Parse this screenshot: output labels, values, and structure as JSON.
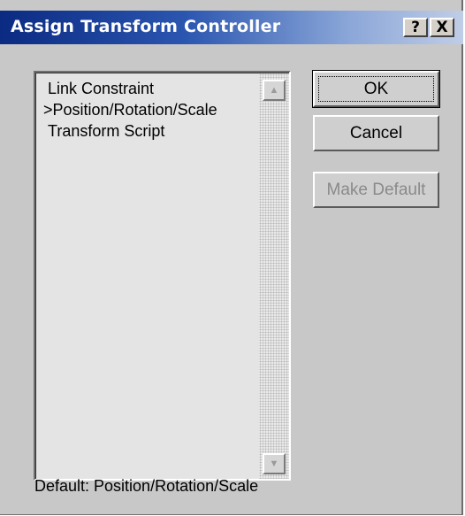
{
  "window": {
    "title": "Assign Transform Controller",
    "help_glyph": "?",
    "close_glyph": "X"
  },
  "list": {
    "items": [
      {
        "label": "Link Constraint",
        "selected": false
      },
      {
        "label": ">Position/Rotation/Scale",
        "selected": true
      },
      {
        "label": "Transform Script",
        "selected": false
      }
    ]
  },
  "buttons": {
    "ok_label": "OK",
    "cancel_label": "Cancel",
    "make_default_label": "Make Default",
    "make_default_enabled": false
  },
  "footer": {
    "default_text": "Default:  Position/Rotation/Scale"
  },
  "colors": {
    "title_bar_start": "#0b2a82",
    "title_bar_end": "#c0cde6",
    "dialog_face": "#c8c8c8"
  }
}
